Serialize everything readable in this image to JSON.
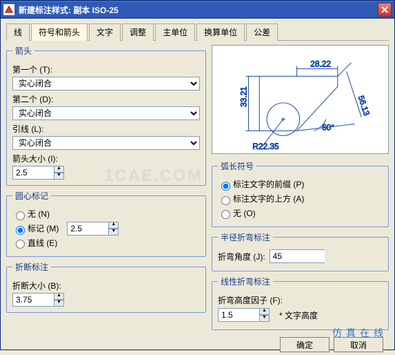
{
  "title": "新建标注样式: 副本 ISO-25",
  "tabs": [
    "线",
    "符号和箭头",
    "文字",
    "调整",
    "主单位",
    "换算单位",
    "公差"
  ],
  "active_tab": 1,
  "arrowheads": {
    "legend": "箭头",
    "first_label": "第一个 (T):",
    "first_value": "实心闭合",
    "second_label": "第二个 (D):",
    "second_value": "实心闭合",
    "leader_label": "引线 (L):",
    "leader_value": "实心闭合",
    "size_label": "箭头大小 (I):",
    "size_value": "2.5"
  },
  "center_marks": {
    "legend": "圆心标记",
    "none": "无 (N)",
    "mark": "标记 (M)",
    "line": "直线 (E)",
    "selected": "mark",
    "size": "2.5"
  },
  "dim_break": {
    "legend": "折断标注",
    "size_label": "折断大小 (B):",
    "size_value": "3.75"
  },
  "arc_length": {
    "legend": "弧长符号",
    "opt_preceding": "标注文字的前缀 (P)",
    "opt_above": "标注文字的上方 (A)",
    "opt_none": "无 (O)",
    "selected": "preceding"
  },
  "radius_jog": {
    "legend": "半径折弯标注",
    "angle_label": "折弯角度 (J):",
    "angle_value": "45"
  },
  "linear_jog": {
    "legend": "线性折弯标注",
    "height_label": "折弯高度因子 (F):",
    "height_value": "1.5",
    "hint": "* 文字高度"
  },
  "chart_data": {
    "type": "diagram",
    "dimensions": {
      "top_width": "28.22",
      "left_height": "33.21",
      "diagonal": "56.13",
      "angle": "60°",
      "radius": "R22.35"
    }
  },
  "buttons": {
    "ok": "确定",
    "cancel": "取消"
  },
  "watermark": "仿真在线",
  "watermark_faint": "1CAE.COM"
}
